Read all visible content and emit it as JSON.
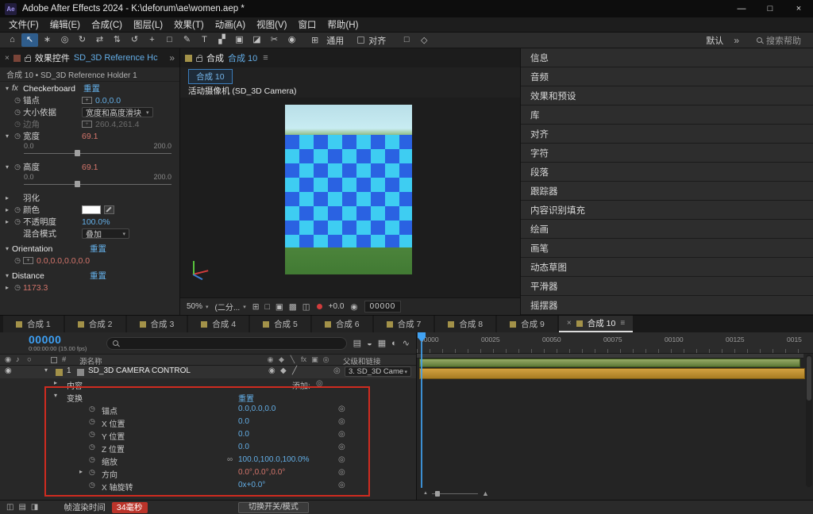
{
  "icons": {
    "twirl_open": "▾",
    "twirl_closed": "▸",
    "chevron_down": "▾",
    "menu": "≡",
    "close_small": "×",
    "overflow": "»",
    "stopwatch": "◷",
    "link": "∞",
    "pickwhip": "◎",
    "eye": "◉",
    "audio": "♪",
    "solo": "○",
    "plus": "+",
    "mountain": "▲",
    "grid": "⊞"
  },
  "titlebar": {
    "app_icon_text": "Ae",
    "app_title": "Adobe After Effects 2024 - K:\\deforum\\ae\\women.aep *",
    "minimize_glyph": "—",
    "maximize_glyph": "□",
    "close_glyph": "×"
  },
  "menubar": {
    "items": [
      "文件(F)",
      "编辑(E)",
      "合成(C)",
      "图层(L)",
      "效果(T)",
      "动画(A)",
      "视图(V)",
      "窗口",
      "帮助(H)"
    ]
  },
  "toolbar": {
    "tools": [
      {
        "name": "home-tool-icon",
        "glyph": "⌂"
      },
      {
        "name": "selection-tool-icon",
        "glyph": "↖",
        "active": true
      },
      {
        "name": "hand-tool-icon",
        "glyph": "∗"
      },
      {
        "name": "zoom-tool-icon",
        "glyph": "◎"
      },
      {
        "name": "orbit-camera-tool-icon",
        "glyph": "↻"
      },
      {
        "name": "pan-camera-tool-icon",
        "glyph": "⇄"
      },
      {
        "name": "dolly-camera-tool-icon",
        "glyph": "⇅"
      },
      {
        "name": "rotation-tool-icon",
        "glyph": "↺"
      },
      {
        "name": "pan-behind-tool-icon",
        "glyph": "+"
      },
      {
        "name": "rectangle-tool-icon",
        "glyph": "□"
      },
      {
        "name": "pen-tool-icon",
        "glyph": "✎"
      },
      {
        "name": "type-tool-icon",
        "glyph": "T"
      },
      {
        "name": "brush-tool-icon",
        "glyph": "▞"
      },
      {
        "name": "clone-stamp-tool-icon",
        "glyph": "▣"
      },
      {
        "name": "eraser-tool-icon",
        "glyph": "◪"
      },
      {
        "name": "roto-brush-tool-icon",
        "glyph": "✂"
      },
      {
        "name": "puppet-pin-tool-icon",
        "glyph": "◉"
      }
    ],
    "tongyong_label": "通用",
    "align_label": "对齐",
    "extra_icons": [
      {
        "name": "mask-path-icon",
        "glyph": "□"
      },
      {
        "name": "guides-icon",
        "glyph": "◇"
      }
    ],
    "workspace_label": "默认",
    "search_placeholder": "搜索帮助"
  },
  "effects_panel": {
    "tab_label": "效果控件",
    "tab_target": "SD_3D Reference Hc",
    "breadcrumb": "合成 10 • SD_3D Reference Holder 1",
    "checkerboard": {
      "fx_badge": "fx",
      "name": "Checkerboard",
      "reset_label": "重置",
      "anchor_label": "锚点",
      "anchor_value": "0.0,0.0",
      "size_mode_label": "大小依据",
      "size_mode_value": "宽度和高度滑块",
      "corner_label": "边角",
      "corner_value": "260.4,261.4",
      "width_label": "宽度",
      "width_value": "69.1",
      "range_min": "0.0",
      "range_max": "200.0",
      "height_label": "高度",
      "height_value": "69.1",
      "feather_label": "羽化",
      "color_label": "颜色",
      "opacity_label": "不透明度",
      "opacity_value": "100.0%",
      "blend_label": "混合模式",
      "blend_value": "叠加"
    },
    "orientation_name": "Orientation",
    "orientation_reset": "重置",
    "orientation_value": "0.0,0.0,0.0,0.0",
    "distance_name": "Distance",
    "distance_reset": "重置",
    "distance_value": "1173.3"
  },
  "viewer": {
    "tab_label": "合成",
    "tab_target": "合成 10",
    "comp_chip": "合成 10",
    "camera_label": "活动摄像机 (SD_3D Camera)",
    "zoom_value": "50%",
    "resolution_value": "(二分...",
    "bottom_icons": [
      {
        "name": "choose-grid-icon",
        "glyph": "⊞"
      },
      {
        "name": "mask-visibility-icon",
        "glyph": "□"
      },
      {
        "name": "region-of-interest-icon",
        "glyph": "▣"
      },
      {
        "name": "transparency-grid-icon",
        "glyph": "▩"
      },
      {
        "name": "timeline-button-icon",
        "glyph": "◫"
      }
    ],
    "exposure_value": "+0.0",
    "timecode": "00000"
  },
  "right_panels": [
    "信息",
    "音频",
    "效果和预设",
    "库",
    "对齐",
    "字符",
    "段落",
    "跟踪器",
    "内容识别填充",
    "绘画",
    "画笔",
    "动态草图",
    "平滑器",
    "摇摆器"
  ],
  "comp_tabs": {
    "tabs": [
      "合成 1",
      "合成 2",
      "合成 3",
      "合成 4",
      "合成 5",
      "合成 6",
      "合成 7",
      "合成 8",
      "合成 9",
      "合成 10"
    ],
    "active_index": 9
  },
  "timeline": {
    "timecode": "00000",
    "timecode_sub": "0:00:00:00 (15.00 fps)",
    "top_icons": [
      {
        "name": "mini-flowchart-icon",
        "glyph": "▤"
      },
      {
        "name": "shy-layers-icon",
        "glyph": "◒"
      },
      {
        "name": "frame-blend-icon",
        "glyph": "▦"
      },
      {
        "name": "motion-blur-icon",
        "glyph": "◐"
      },
      {
        "name": "graph-editor-icon",
        "glyph": "∿"
      }
    ],
    "columns": {
      "hash": "#",
      "source_name": "源名称",
      "parent": "父级和链接"
    },
    "col_icons": [
      {
        "name": "video-switch-icon",
        "glyph": "◉"
      },
      {
        "name": "quality-switch-icon",
        "glyph": "◆"
      },
      {
        "name": "mask-switch-icon",
        "glyph": "╲"
      },
      {
        "name": "fx-switch-icon",
        "glyph": "fx"
      },
      {
        "name": "modes-switch-icon",
        "glyph": "▣"
      },
      {
        "name": "trkmat-switch-icon",
        "glyph": "◎"
      }
    ],
    "layer": {
      "index": "1",
      "name": "SD_3D CAMERA CONTROL",
      "switch_icons": [
        {
          "name": "layer-video-icon",
          "glyph": "◉"
        },
        {
          "name": "layer-quality-icon",
          "glyph": "◆"
        },
        {
          "name": "layer-fx-icon",
          "glyph": "╱"
        }
      ],
      "parent_value": "3. SD_3D Came"
    },
    "contents_label": "内容",
    "add_label": "添加:",
    "transform_label": "变换",
    "transform_reset": "重置",
    "props": [
      {
        "label": "锚点",
        "value": "0.0,0.0,0.0"
      },
      {
        "label": "X 位置",
        "value": "0.0"
      },
      {
        "label": "Y 位置",
        "value": "0.0"
      },
      {
        "label": "Z 位置",
        "value": "0.0"
      },
      {
        "label": "缩放",
        "value": "100.0,100.0,100.0%"
      },
      {
        "label": "方向",
        "value": "0.0°,0.0°,0.0°"
      },
      {
        "label": "X 轴旋转",
        "value": "0x+0.0°"
      }
    ],
    "ruler_labels": [
      "00000",
      "00025",
      "00050",
      "00075",
      "00100",
      "00125",
      "0015"
    ]
  },
  "statusbar": {
    "icons": [
      {
        "name": "expand-layer-pane-icon",
        "glyph": "◫"
      },
      {
        "name": "switches-pane-icon",
        "glyph": "▤"
      },
      {
        "name": "transfer-modes-pane-icon",
        "glyph": "◨"
      }
    ],
    "render_label": "帧渲染时间",
    "render_value": "34毫秒",
    "toggle_button": "切换开关/模式"
  }
}
